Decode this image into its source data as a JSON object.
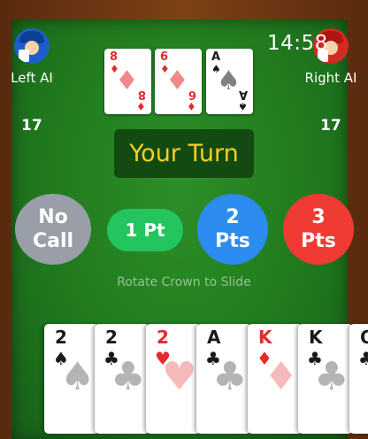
{
  "status_bar": {
    "time": "14:58"
  },
  "players": {
    "left": {
      "name": "Left AI",
      "score": "17",
      "avatar": "blue-cap-avatar"
    },
    "right": {
      "name": "Right AI",
      "score": "17",
      "avatar": "red-cap-avatar"
    }
  },
  "trick": [
    {
      "rank": "8",
      "suit": "♦",
      "color": "#e42b2b"
    },
    {
      "rank": "6",
      "suit": "♦",
      "color": "#e42b2b"
    },
    {
      "rank": "A",
      "suit": "♠",
      "color": "#1a1a1a"
    }
  ],
  "turn_banner": "Your Turn",
  "bids": [
    {
      "label": "No Call",
      "color": "#9a9ea8"
    },
    {
      "label": "1 Pt",
      "color": "#22c55e"
    },
    {
      "label": "2 Pts",
      "color": "#2d8cf0"
    },
    {
      "label": "3 Pts",
      "color": "#ef3b33"
    }
  ],
  "hint": "Rotate Crown to Slide",
  "hand": [
    {
      "rank": "2",
      "suit": "♠",
      "color": "#1a1a1a"
    },
    {
      "rank": "2",
      "suit": "♣",
      "color": "#1a1a1a"
    },
    {
      "rank": "2",
      "suit": "♥",
      "color": "#e42b2b"
    },
    {
      "rank": "A",
      "suit": "♣",
      "color": "#1a1a1a"
    },
    {
      "rank": "K",
      "suit": "♦",
      "color": "#e42b2b"
    },
    {
      "rank": "K",
      "suit": "♣",
      "color": "#1a1a1a"
    },
    {
      "rank": "Q",
      "suit": "♣",
      "color": "#1a1a1a"
    }
  ]
}
